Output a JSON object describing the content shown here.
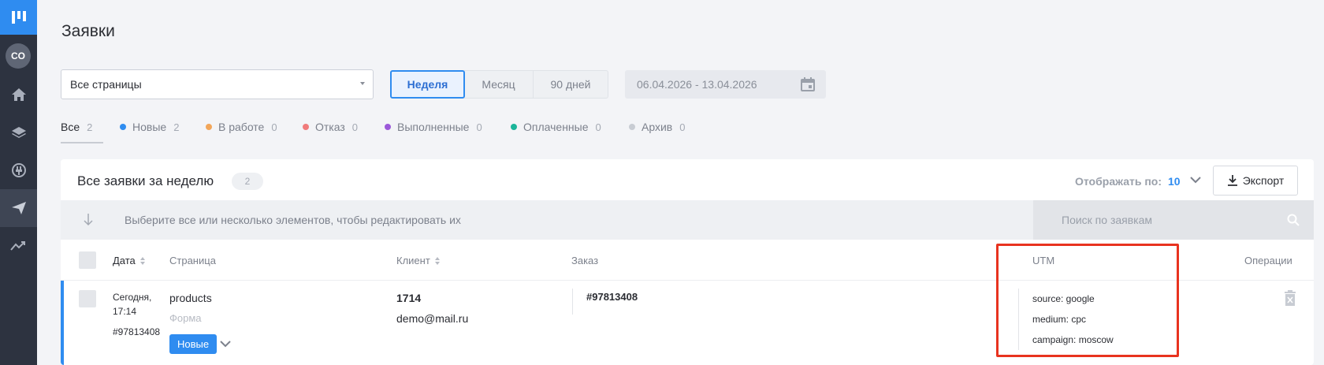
{
  "sidebar": {
    "avatar": "CO",
    "items": [
      {
        "icon": "home-icon"
      },
      {
        "icon": "layers-icon"
      },
      {
        "icon": "plug-icon"
      },
      {
        "icon": "send-icon"
      },
      {
        "icon": "analytics-icon"
      }
    ]
  },
  "page": {
    "title": "Заявки"
  },
  "filters": {
    "pages_select": "Все страницы",
    "periods": [
      "Неделя",
      "Месяц",
      "90 дней"
    ],
    "active_period": "Неделя",
    "date_range": "06.04.2026 - 13.04.2026"
  },
  "status_tabs": [
    {
      "label": "Все",
      "count": "2",
      "color": null
    },
    {
      "label": "Новые",
      "count": "2",
      "color": "#2f8cf0"
    },
    {
      "label": "В работе",
      "count": "0",
      "color": "#f2a65a"
    },
    {
      "label": "Отказ",
      "count": "0",
      "color": "#f07b7b"
    },
    {
      "label": "Выполненные",
      "count": "0",
      "color": "#9b59d9"
    },
    {
      "label": "Оплаченные",
      "count": "0",
      "color": "#1bb59a"
    },
    {
      "label": "Архив",
      "count": "0",
      "color": "#c8ccd3"
    }
  ],
  "card": {
    "title": "Все заявки за неделю",
    "count": "2",
    "per_page_label": "Отображать по:",
    "per_page_value": "10",
    "export_label": "Экспорт",
    "bulk_hint": "Выберите все или несколько элементов, чтобы редактировать их",
    "search_placeholder": "Поиск по заявкам"
  },
  "table": {
    "headers": {
      "date": "Дата",
      "page": "Страница",
      "client": "Клиент",
      "order": "Заказ",
      "utm": "UTM",
      "operations": "Операции"
    },
    "rows": [
      {
        "date_line1": "Сегодня,",
        "date_line2": "17:14",
        "id": "#97813408",
        "page": "products",
        "form": "Форма",
        "status": "Новые",
        "client_name": "1714",
        "client_email": "demo@mail.ru",
        "order": "#97813408",
        "utm": [
          "source: google",
          "medium: cpc",
          "campaign: moscow"
        ]
      }
    ]
  }
}
